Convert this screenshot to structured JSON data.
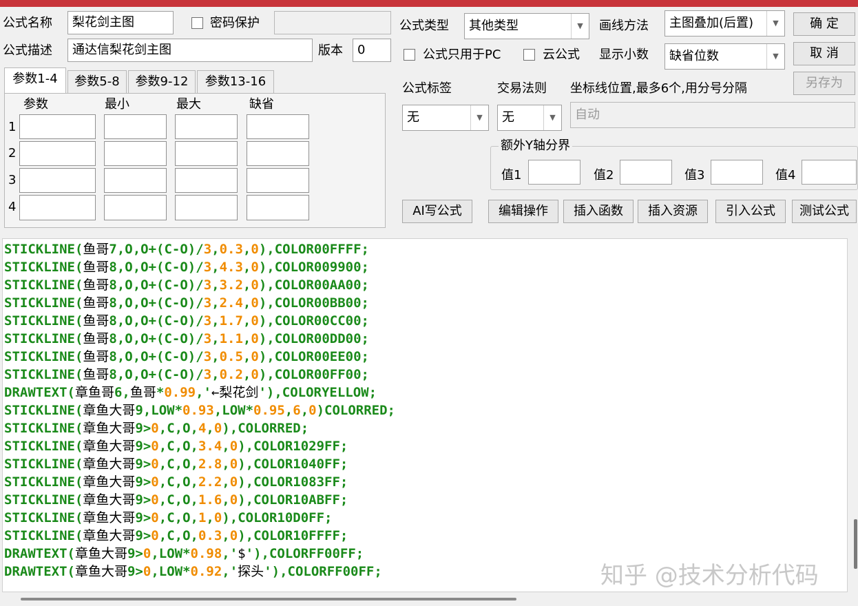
{
  "colors": {
    "keyword": "#1a8a1a",
    "number": "#f08c00",
    "text": "#000000"
  },
  "header": {
    "name_label": "公式名称",
    "name_value": "梨花剑主图",
    "password_label": "密码保护",
    "password_value": "",
    "desc_label": "公式描述",
    "desc_value": "通达信梨花剑主图",
    "version_label": "版本",
    "version_value": "0",
    "type_label": "公式类型",
    "type_value": "其他类型",
    "draw_label": "画线方法",
    "draw_value": "主图叠加(后置)",
    "pc_only_label": "公式只用于PC",
    "cloud_label": "云公式",
    "decimals_label": "显示小数",
    "decimals_value": "缺省位数"
  },
  "buttons": {
    "ok": "确 定",
    "cancel": "取 消",
    "save_as": "另存为",
    "ai": "AI写公式",
    "edit": "编辑操作",
    "insert_func": "插入函数",
    "insert_res": "插入资源",
    "import": "引入公式",
    "test": "测试公式"
  },
  "tabs": [
    "参数1-4",
    "参数5-8",
    "参数9-12",
    "参数13-16"
  ],
  "params": {
    "headers": [
      "参数",
      "最小",
      "最大",
      "缺省"
    ],
    "rows": [
      "1",
      "2",
      "3",
      "4"
    ]
  },
  "right": {
    "tag_label": "公式标签",
    "tag_value": "无",
    "trade_label": "交易法则",
    "trade_value": "无",
    "axis_label": "坐标线位置,最多6个,用分号分隔",
    "axis_value": "自动",
    "yaxis_group": "额外Y轴分界",
    "v1": "值1",
    "v2": "值2",
    "v3": "值3",
    "v4": "值4"
  },
  "code_lines": [
    [
      [
        "k",
        "STICKLINE("
      ],
      [
        "t",
        "鱼哥"
      ],
      [
        "k",
        "7,O,O+(C-O)/"
      ],
      [
        "n",
        "3"
      ],
      [
        "k",
        ","
      ],
      [
        "n",
        "0.3"
      ],
      [
        "k",
        ","
      ],
      [
        "n",
        "0"
      ],
      [
        "k",
        "),COLOR00FFFF;"
      ]
    ],
    [
      [
        "k",
        "STICKLINE("
      ],
      [
        "t",
        "鱼哥"
      ],
      [
        "k",
        "8,O,O+(C-O)/"
      ],
      [
        "n",
        "3"
      ],
      [
        "k",
        ","
      ],
      [
        "n",
        "4.3"
      ],
      [
        "k",
        ","
      ],
      [
        "n",
        "0"
      ],
      [
        "k",
        "),COLOR009900;"
      ]
    ],
    [
      [
        "k",
        "STICKLINE("
      ],
      [
        "t",
        "鱼哥"
      ],
      [
        "k",
        "8,O,O+(C-O)/"
      ],
      [
        "n",
        "3"
      ],
      [
        "k",
        ","
      ],
      [
        "n",
        "3.2"
      ],
      [
        "k",
        ","
      ],
      [
        "n",
        "0"
      ],
      [
        "k",
        "),COLOR00AA00;"
      ]
    ],
    [
      [
        "k",
        "STICKLINE("
      ],
      [
        "t",
        "鱼哥"
      ],
      [
        "k",
        "8,O,O+(C-O)/"
      ],
      [
        "n",
        "3"
      ],
      [
        "k",
        ","
      ],
      [
        "n",
        "2.4"
      ],
      [
        "k",
        ","
      ],
      [
        "n",
        "0"
      ],
      [
        "k",
        "),COLOR00BB00;"
      ]
    ],
    [
      [
        "k",
        "STICKLINE("
      ],
      [
        "t",
        "鱼哥"
      ],
      [
        "k",
        "8,O,O+(C-O)/"
      ],
      [
        "n",
        "3"
      ],
      [
        "k",
        ","
      ],
      [
        "n",
        "1.7"
      ],
      [
        "k",
        ","
      ],
      [
        "n",
        "0"
      ],
      [
        "k",
        "),COLOR00CC00;"
      ]
    ],
    [
      [
        "k",
        "STICKLINE("
      ],
      [
        "t",
        "鱼哥"
      ],
      [
        "k",
        "8,O,O+(C-O)/"
      ],
      [
        "n",
        "3"
      ],
      [
        "k",
        ","
      ],
      [
        "n",
        "1.1"
      ],
      [
        "k",
        ","
      ],
      [
        "n",
        "0"
      ],
      [
        "k",
        "),COLOR00DD00;"
      ]
    ],
    [
      [
        "k",
        "STICKLINE("
      ],
      [
        "t",
        "鱼哥"
      ],
      [
        "k",
        "8,O,O+(C-O)/"
      ],
      [
        "n",
        "3"
      ],
      [
        "k",
        ","
      ],
      [
        "n",
        "0.5"
      ],
      [
        "k",
        ","
      ],
      [
        "n",
        "0"
      ],
      [
        "k",
        "),COLOR00EE00;"
      ]
    ],
    [
      [
        "k",
        "STICKLINE("
      ],
      [
        "t",
        "鱼哥"
      ],
      [
        "k",
        "8,O,O+(C-O)/"
      ],
      [
        "n",
        "3"
      ],
      [
        "k",
        ","
      ],
      [
        "n",
        "0.2"
      ],
      [
        "k",
        ","
      ],
      [
        "n",
        "0"
      ],
      [
        "k",
        "),COLOR00FF00;"
      ]
    ],
    [
      [
        "k",
        "DRAWTEXT("
      ],
      [
        "t",
        "章鱼哥"
      ],
      [
        "k",
        "6,"
      ],
      [
        "t",
        "鱼哥"
      ],
      [
        "k",
        "*"
      ],
      [
        "n",
        "0.99"
      ],
      [
        "k",
        ",'"
      ],
      [
        "t",
        "←梨花剑"
      ],
      [
        "k",
        "'),COLORYELLOW;"
      ]
    ],
    [
      [
        "k",
        "STICKLINE("
      ],
      [
        "t",
        "章鱼大哥"
      ],
      [
        "k",
        "9,LOW*"
      ],
      [
        "n",
        "0.93"
      ],
      [
        "k",
        ",LOW*"
      ],
      [
        "n",
        "0.95"
      ],
      [
        "k",
        ","
      ],
      [
        "n",
        "6"
      ],
      [
        "k",
        ","
      ],
      [
        "n",
        "0"
      ],
      [
        "k",
        ")COLORRED;"
      ]
    ],
    [
      [
        "k",
        "STICKLINE("
      ],
      [
        "t",
        "章鱼大哥"
      ],
      [
        "k",
        "9>"
      ],
      [
        "n",
        "0"
      ],
      [
        "k",
        ",C,O,"
      ],
      [
        "n",
        "4"
      ],
      [
        "k",
        ","
      ],
      [
        "n",
        "0"
      ],
      [
        "k",
        "),COLORRED;"
      ]
    ],
    [
      [
        "k",
        "STICKLINE("
      ],
      [
        "t",
        "章鱼大哥"
      ],
      [
        "k",
        "9>"
      ],
      [
        "n",
        "0"
      ],
      [
        "k",
        ",C,O,"
      ],
      [
        "n",
        "3.4"
      ],
      [
        "k",
        ","
      ],
      [
        "n",
        "0"
      ],
      [
        "k",
        "),COLOR1029FF;"
      ]
    ],
    [
      [
        "k",
        "STICKLINE("
      ],
      [
        "t",
        "章鱼大哥"
      ],
      [
        "k",
        "9>"
      ],
      [
        "n",
        "0"
      ],
      [
        "k",
        ",C,O,"
      ],
      [
        "n",
        "2.8"
      ],
      [
        "k",
        ","
      ],
      [
        "n",
        "0"
      ],
      [
        "k",
        "),COLOR1040FF;"
      ]
    ],
    [
      [
        "k",
        "STICKLINE("
      ],
      [
        "t",
        "章鱼大哥"
      ],
      [
        "k",
        "9>"
      ],
      [
        "n",
        "0"
      ],
      [
        "k",
        ",C,O,"
      ],
      [
        "n",
        "2.2"
      ],
      [
        "k",
        ","
      ],
      [
        "n",
        "0"
      ],
      [
        "k",
        "),COLOR1083FF;"
      ]
    ],
    [
      [
        "k",
        "STICKLINE("
      ],
      [
        "t",
        "章鱼大哥"
      ],
      [
        "k",
        "9>"
      ],
      [
        "n",
        "0"
      ],
      [
        "k",
        ",C,O,"
      ],
      [
        "n",
        "1.6"
      ],
      [
        "k",
        ","
      ],
      [
        "n",
        "0"
      ],
      [
        "k",
        "),COLOR10ABFF;"
      ]
    ],
    [
      [
        "k",
        "STICKLINE("
      ],
      [
        "t",
        "章鱼大哥"
      ],
      [
        "k",
        "9>"
      ],
      [
        "n",
        "0"
      ],
      [
        "k",
        ",C,O,"
      ],
      [
        "n",
        "1"
      ],
      [
        "k",
        ","
      ],
      [
        "n",
        "0"
      ],
      [
        "k",
        "),COLOR10D0FF;"
      ]
    ],
    [
      [
        "k",
        "STICKLINE("
      ],
      [
        "t",
        "章鱼大哥"
      ],
      [
        "k",
        "9>"
      ],
      [
        "n",
        "0"
      ],
      [
        "k",
        ",C,O,"
      ],
      [
        "n",
        "0.3"
      ],
      [
        "k",
        ","
      ],
      [
        "n",
        "0"
      ],
      [
        "k",
        "),COLOR10FFFF;"
      ]
    ],
    [
      [
        "k",
        "DRAWTEXT("
      ],
      [
        "t",
        "章鱼大哥"
      ],
      [
        "k",
        "9>"
      ],
      [
        "n",
        "0"
      ],
      [
        "k",
        ",LOW*"
      ],
      [
        "n",
        "0.98"
      ],
      [
        "k",
        ",'"
      ],
      [
        "t",
        "$"
      ],
      [
        "k",
        "'),COLORFF00FF;"
      ]
    ],
    [
      [
        "k",
        "DRAWTEXT("
      ],
      [
        "t",
        "章鱼大哥"
      ],
      [
        "k",
        "9>"
      ],
      [
        "n",
        "0"
      ],
      [
        "k",
        ",LOW*"
      ],
      [
        "n",
        "0.92"
      ],
      [
        "k",
        ",'"
      ],
      [
        "t",
        "探头"
      ],
      [
        "k",
        "'),COLORFF00FF;"
      ]
    ]
  ],
  "watermark": "知乎 @技术分析代码"
}
